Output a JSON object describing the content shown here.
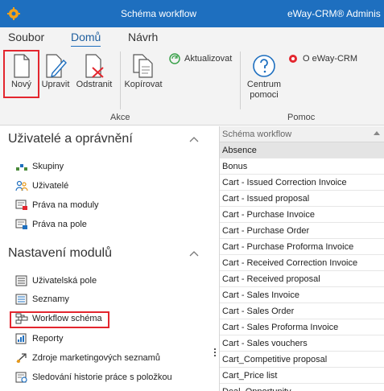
{
  "titlebar": {
    "title": "Schéma workflow",
    "brand": "eWay-CRM® Adminis"
  },
  "tabs": [
    {
      "label": "Soubor"
    },
    {
      "label": "Domů",
      "active": true
    },
    {
      "label": "Návrh"
    }
  ],
  "ribbon": {
    "buttons": {
      "new": "Nový",
      "edit": "Upravit",
      "delete": "Odstranit",
      "copy": "Kopírovat",
      "refresh": "Aktualizovat",
      "help": "Centrum pomoci",
      "about": "O eWay-CRM"
    },
    "groups": {
      "actions": "Akce",
      "help": "Pomoc"
    }
  },
  "sidebar": {
    "sections": [
      {
        "title": "Uživatelé a oprávnění",
        "items": [
          {
            "label": "Skupiny",
            "icon": "groups-icon"
          },
          {
            "label": "Uživatelé",
            "icon": "users-icon"
          },
          {
            "label": "Práva na moduly",
            "icon": "module-permissions-icon"
          },
          {
            "label": "Práva na pole",
            "icon": "field-permissions-icon"
          }
        ]
      },
      {
        "title": "Nastavení modulů",
        "items": [
          {
            "label": "Uživatelská pole",
            "icon": "user-fields-icon"
          },
          {
            "label": "Seznamy",
            "icon": "lists-icon"
          },
          {
            "label": "Workflow schéma",
            "icon": "workflow-icon",
            "highlighted": true
          },
          {
            "label": "Reporty",
            "icon": "reports-icon"
          },
          {
            "label": "Zdroje marketingových seznamů",
            "icon": "marketing-sources-icon"
          },
          {
            "label": "Sledování historie práce s položkou",
            "icon": "history-tracking-icon"
          }
        ]
      }
    ]
  },
  "list": {
    "header": "Schéma workflow",
    "rows": [
      "Absence",
      "Bonus",
      "Cart - Issued Correction Invoice",
      "Cart - Issued proposal",
      "Cart - Purchase Invoice",
      "Cart - Purchase Order",
      "Cart - Purchase Proforma Invoice",
      "Cart - Received Correction Invoice",
      "Cart - Received proposal",
      "Cart - Sales Invoice",
      "Cart - Sales Order",
      "Cart - Sales Proforma Invoice",
      "Cart - Sales vouchers",
      "Cart_Competitive proposal",
      "Cart_Price list",
      "Deal_Opportunity"
    ],
    "selected_index": 0
  },
  "colors": {
    "titlebar": "#1e6fbf",
    "highlight": "#e3262e",
    "accent": "#1e5e9e"
  }
}
